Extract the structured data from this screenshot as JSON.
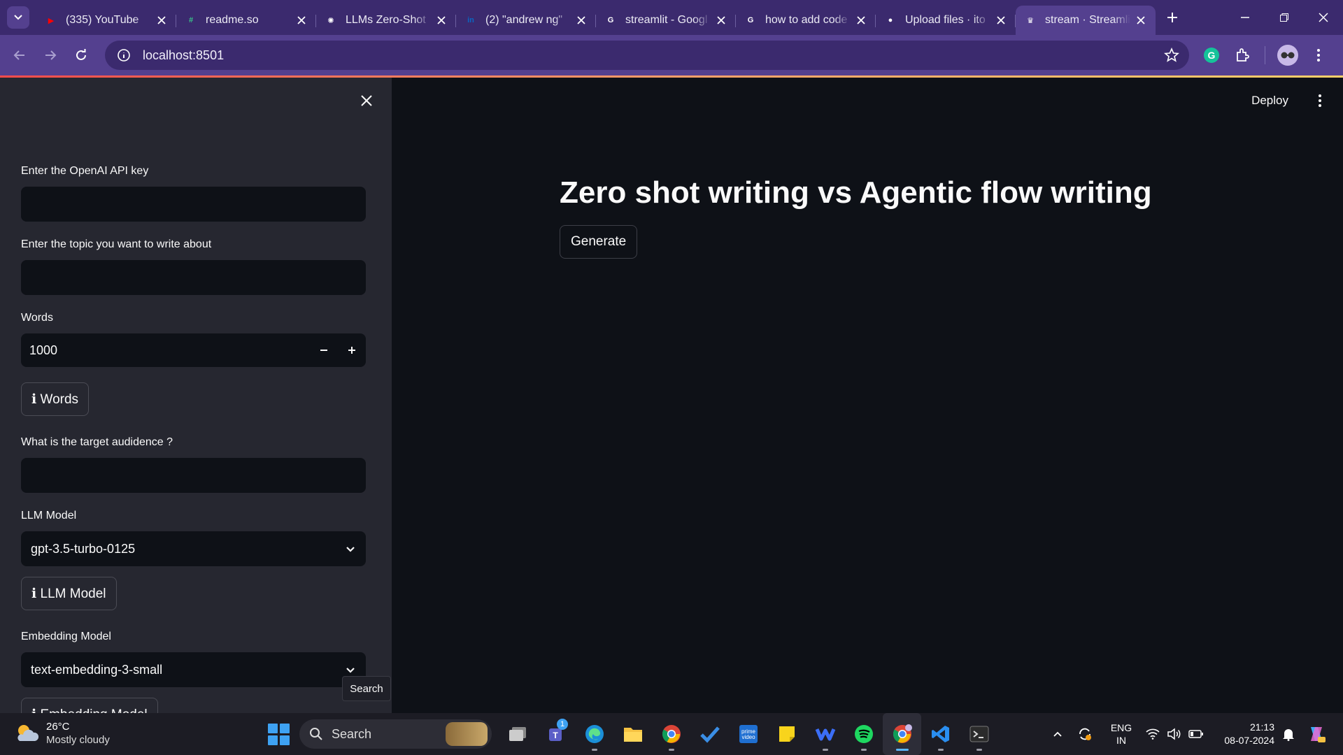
{
  "browser": {
    "tabs": [
      {
        "title": "(335) YouTube",
        "icon": "youtube-icon",
        "favicon_text": "▶",
        "favicon_color": "#ff0000"
      },
      {
        "title": "readme.so",
        "icon": "readme-icon",
        "favicon_text": "#",
        "favicon_color": "#39c48a"
      },
      {
        "title": "LLMs Zero-Shot",
        "icon": "openai-icon",
        "favicon_text": "✺",
        "favicon_color": "#ffffff"
      },
      {
        "title": "(2) \"andrew ng\"",
        "icon": "linkedin-icon",
        "favicon_text": "in",
        "favicon_color": "#0a66c2"
      },
      {
        "title": "streamlit - Googl",
        "icon": "google-icon",
        "favicon_text": "G",
        "favicon_color": "#ffffff"
      },
      {
        "title": "how to add code",
        "icon": "google-icon",
        "favicon_text": "G",
        "favicon_color": "#ffffff"
      },
      {
        "title": "Upload files · ito",
        "icon": "github-icon",
        "favicon_text": "●",
        "favicon_color": "#ffffff"
      },
      {
        "title": "stream · Streamli",
        "icon": "streamlit-icon",
        "favicon_text": "♛",
        "favicon_color": "#ffffff",
        "active": true
      }
    ],
    "url": "localhost:8501"
  },
  "sidebar": {
    "api_key_label": "Enter the OpenAI API key",
    "api_key_value": "",
    "topic_label": "Enter the topic you want to write about",
    "topic_value": "",
    "words_label": "Words",
    "words_value": "1000",
    "words_info": "ℹ Words",
    "audience_label": "What is the target audidence ?",
    "audience_value": "",
    "llm_label": "LLM Model",
    "llm_value": "gpt-3.5-turbo-0125",
    "llm_info": "ℹ LLM Model",
    "embedding_label": "Embedding Model",
    "embedding_value": "text-embedding-3-small",
    "embedding_info": "ℹ Embedding Model"
  },
  "main": {
    "deploy_label": "Deploy",
    "title": "Zero shot writing vs Agentic flow writing",
    "generate_label": "Generate"
  },
  "tooltip": "Search",
  "taskbar": {
    "weather_temp": "26°C",
    "weather_desc": "Mostly cloudy",
    "search_label": "Search",
    "teams_badge": "1",
    "lang_top": "ENG",
    "lang_bottom": "IN",
    "time": "21:13",
    "date": "08-07-2024"
  },
  "colors": {
    "browser_frame": "#3b2a6e",
    "toolbar": "#54408f",
    "sidebar_bg": "#262730",
    "main_bg": "#0e1117",
    "accent": "#ff4b4b"
  }
}
